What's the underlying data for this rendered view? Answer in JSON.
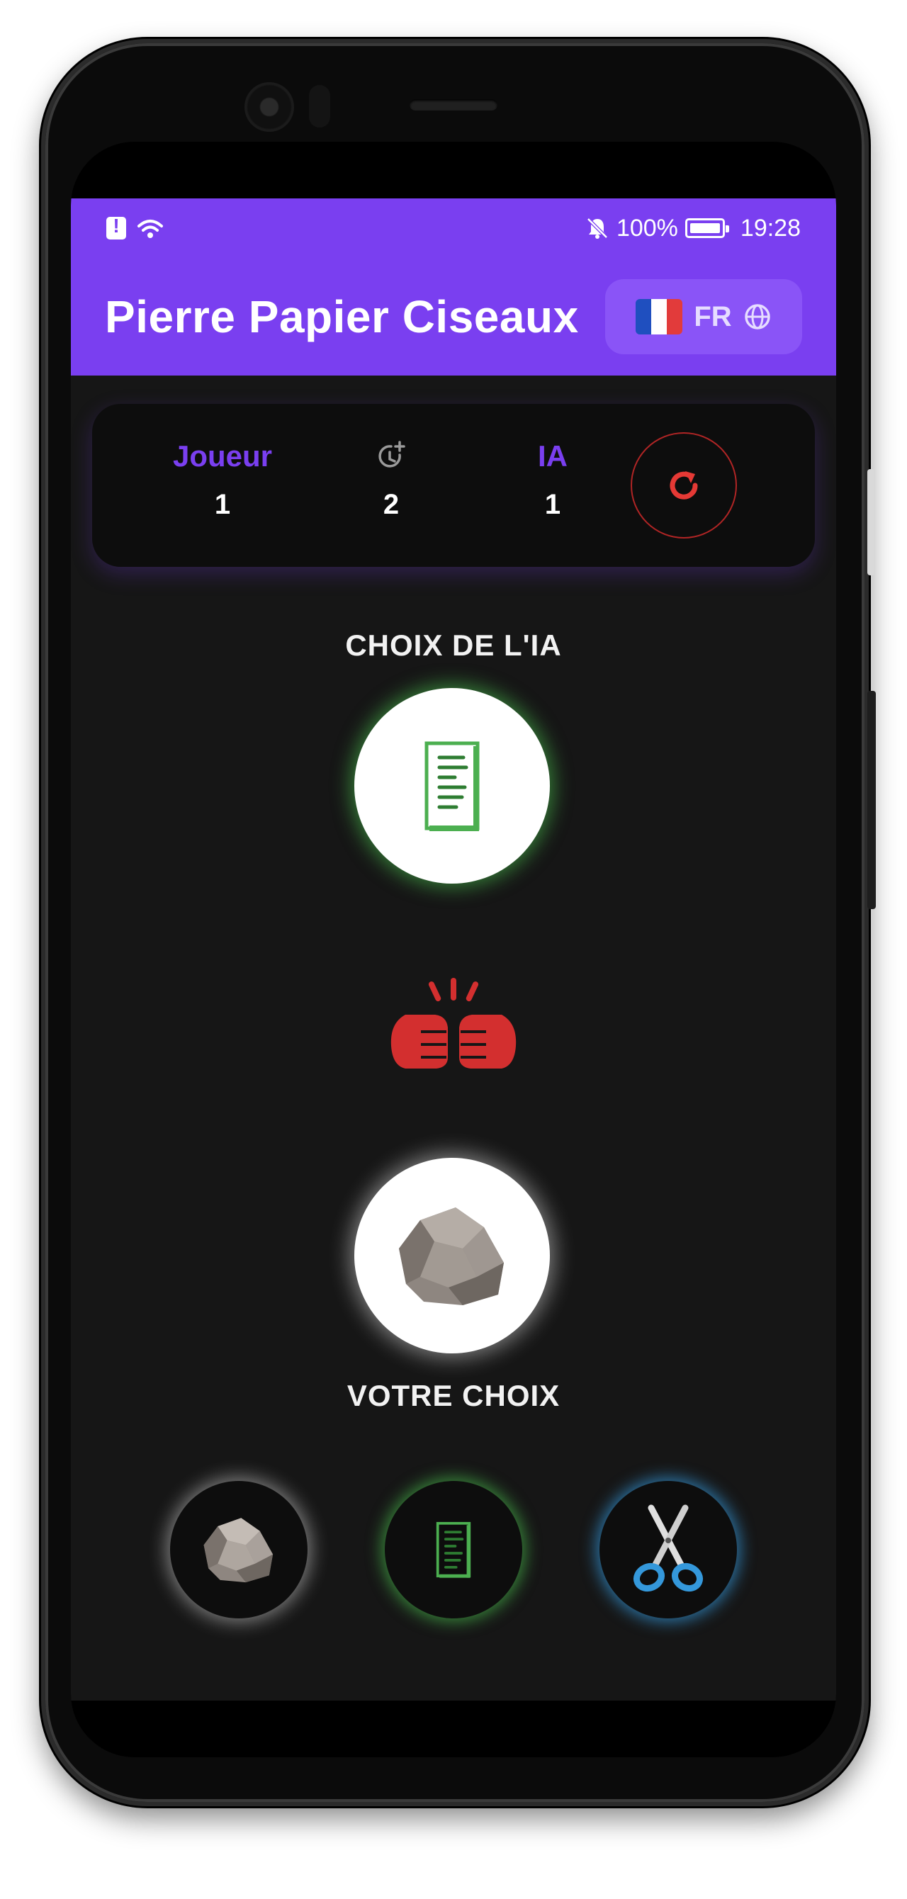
{
  "status_bar": {
    "battery": "100%",
    "time": "19:28"
  },
  "app_bar": {
    "title": "Pierre Papier Ciseaux",
    "language_code": "FR",
    "flag_icon": "france-flag-icon",
    "globe_icon": "globe-icon"
  },
  "scoreboard": {
    "player_label": "Joueur",
    "player_score": "1",
    "draws_icon": "timer-plus-icon",
    "draws_score": "2",
    "ai_label": "IA",
    "ai_score": "1",
    "reset_icon": "refresh-icon"
  },
  "arena": {
    "ai_choice_title": "CHOIX DE L'IA",
    "ai_choice_icon": "paper-icon",
    "versus_icon": "fist-bump-icon",
    "player_choice_icon": "rock-icon",
    "player_choice_title": "VOTRE CHOIX"
  },
  "choices": [
    {
      "icon": "rock-icon",
      "name": "rock"
    },
    {
      "icon": "paper-icon",
      "name": "paper"
    },
    {
      "icon": "scissors-icon",
      "name": "scissors"
    }
  ],
  "colors": {
    "accent": "#7a3ff0",
    "background": "#161616",
    "card": "#0d0d0d",
    "danger": "#e53935",
    "paper_green": "#4caf50",
    "scissors_blue": "#3498db"
  }
}
